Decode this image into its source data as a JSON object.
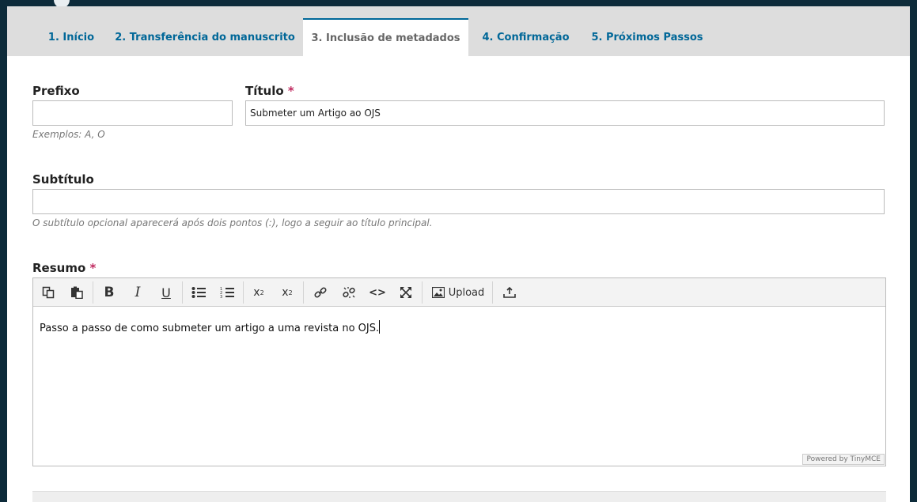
{
  "tabs": [
    {
      "label": "1. Início"
    },
    {
      "label": "2. Transferência do manuscrito"
    },
    {
      "label": "3. Inclusão de metadados"
    },
    {
      "label": "4. Confirmação"
    },
    {
      "label": "5. Próximos Passos"
    }
  ],
  "active_tab": 2,
  "fields": {
    "prefix": {
      "label": "Prefixo",
      "value": "",
      "help": "Exemplos: A, O"
    },
    "title": {
      "label": "Título",
      "required_mark": "*",
      "value": "Submeter um Artigo ao OJS"
    },
    "subtitle": {
      "label": "Subtítulo",
      "value": "",
      "help": "O subtítulo opcional aparecerá após dois pontos (:), logo a seguir ao título principal."
    },
    "abstract": {
      "label": "Resumo",
      "required_mark": "*",
      "content": "Passo a passo de como submeter um artigo a uma revista no OJS."
    }
  },
  "toolbar": {
    "upload_label": "Upload",
    "buttons": [
      "copy-icon",
      "paste-icon",
      "bold-icon",
      "italic-icon",
      "underline-icon",
      "bullet-list-icon",
      "numbered-list-icon",
      "superscript-icon",
      "subscript-icon",
      "link-icon",
      "unlink-icon",
      "code-icon",
      "fullscreen-icon",
      "image-icon",
      "download-icon"
    ]
  },
  "editor": {
    "powered_by": "Powered by TinyMCE"
  },
  "colors": {
    "accent": "#006798",
    "required": "#c0295f",
    "background": "#0d2b3a"
  }
}
